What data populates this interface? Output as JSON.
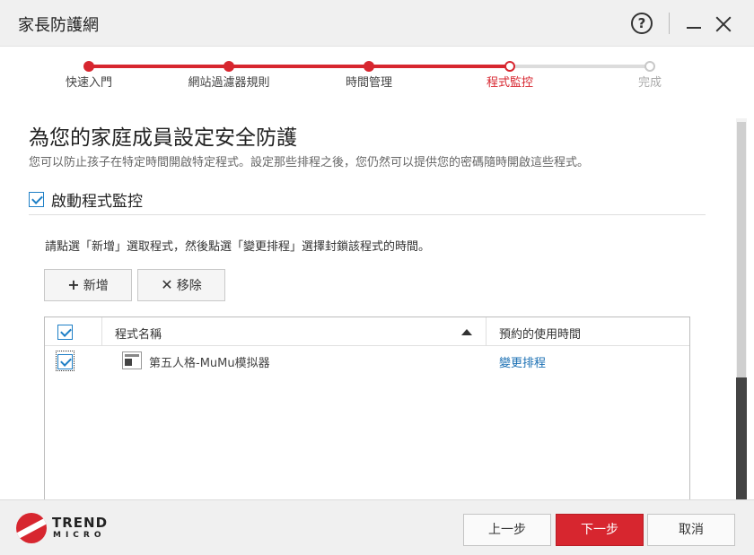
{
  "window": {
    "title": "家長防護網"
  },
  "stepper": {
    "steps": [
      {
        "label": "快速入門",
        "state": "done"
      },
      {
        "label": "網站過濾器規則",
        "state": "done"
      },
      {
        "label": "時間管理",
        "state": "done"
      },
      {
        "label": "程式監控",
        "state": "current"
      },
      {
        "label": "完成",
        "state": "todo"
      }
    ]
  },
  "main": {
    "heading": "為您的家庭成員設定安全防護",
    "subheading": "您可以防止孩子在特定時間開啟特定程式。設定那些排程之後，您仍然可以提供您的密碼隨時開啟這些程式。",
    "enable_label": "啟動程式監控",
    "enable_checked": true,
    "instruction": "請點選「新增」選取程式，然後點選「變更排程」選擇封鎖該程式的時間。",
    "add_label": "新增",
    "remove_label": "移除"
  },
  "table": {
    "columns": {
      "name": "程式名稱",
      "time": "預約的使用時間"
    },
    "rows": [
      {
        "checked": true,
        "name": "第五人格-MuMu模拟器",
        "action": "變更排程"
      }
    ]
  },
  "footer": {
    "logo_line1": "TREND",
    "logo_line2": "MICRO",
    "back_label": "上一步",
    "next_label": "下一步",
    "cancel_label": "取消"
  },
  "colors": {
    "accent": "#d7262f",
    "link": "#1a6fb3",
    "checkbox": "#1e7fc6"
  }
}
